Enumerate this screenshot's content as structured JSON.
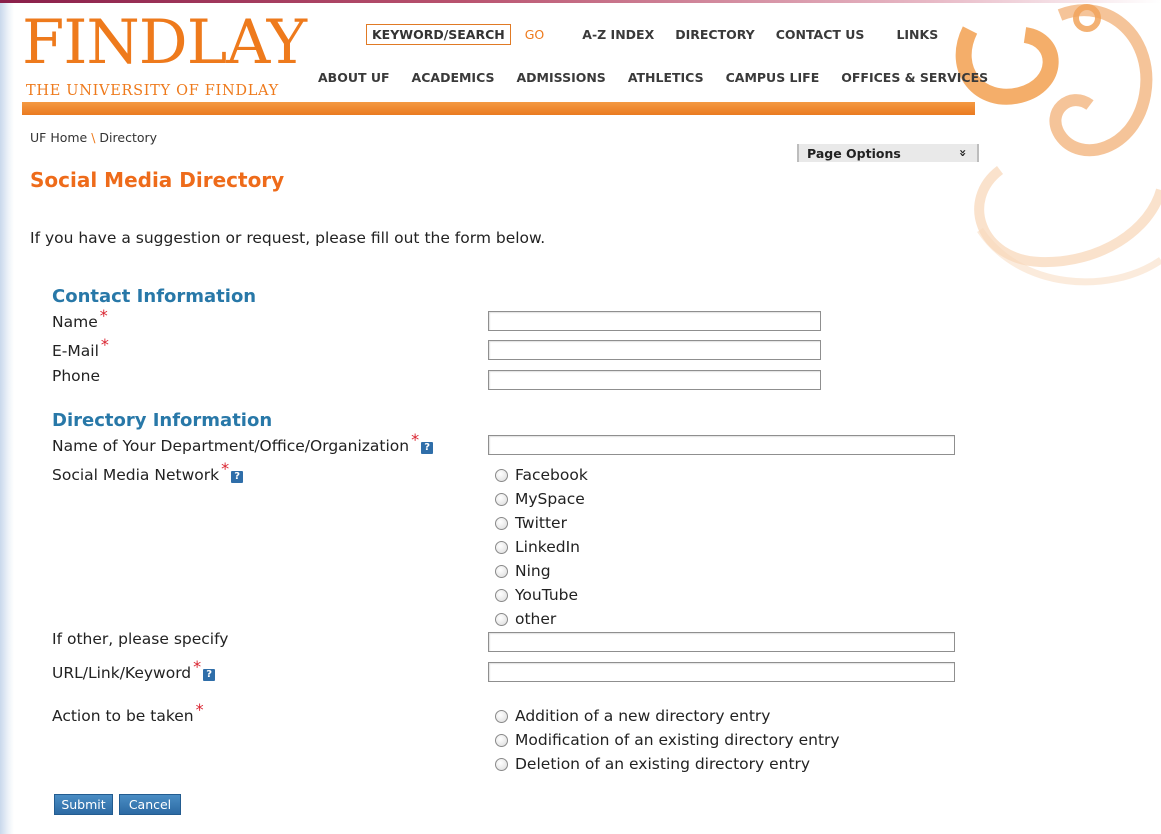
{
  "header": {
    "logo_word": "FINDLAY",
    "logo_sub": "THE UNIVERSITY OF FINDLAY",
    "search_box": "KEYWORD/SEARCH",
    "go": "GO",
    "top_links": [
      "A-Z INDEX",
      "DIRECTORY",
      "CONTACT US",
      "LINKS"
    ],
    "main_links": [
      "ABOUT UF",
      "ACADEMICS",
      "ADMISSIONS",
      "ATHLETICS",
      "CAMPUS LIFE",
      "OFFICES & SERVICES"
    ]
  },
  "breadcrumb": {
    "home": "UF Home",
    "separator": "\\",
    "current": "Directory"
  },
  "page_options": {
    "label": "Page Options",
    "chevron": "»"
  },
  "page_title": "Social Media Directory",
  "intro": "If you have a suggestion or request, please fill out the form below.",
  "form": {
    "contact_section": "Contact Information",
    "name_label": "Name",
    "email_label": "E-Mail",
    "phone_label": "Phone",
    "directory_section": "Directory Information",
    "department_label": "Name of Your Department/Office/Organization",
    "network_label": "Social Media Network",
    "networks": [
      "Facebook",
      "MySpace",
      "Twitter",
      "LinkedIn",
      "Ning",
      "YouTube",
      "other"
    ],
    "other_label": "If other, please specify",
    "url_label": "URL/Link/Keyword",
    "action_label": "Action to be taken",
    "actions": [
      "Addition of a new directory entry",
      "Modification of an existing directory entry",
      "Deletion of an existing directory entry"
    ],
    "required_mark": "*",
    "help_mark": "?",
    "submit": "Submit",
    "cancel": "Cancel"
  },
  "colors": {
    "brand_orange": "#ee7a1c",
    "section_blue": "#2878a8",
    "required_red": "#d9232f",
    "button_blue": "#2c6aa3"
  }
}
